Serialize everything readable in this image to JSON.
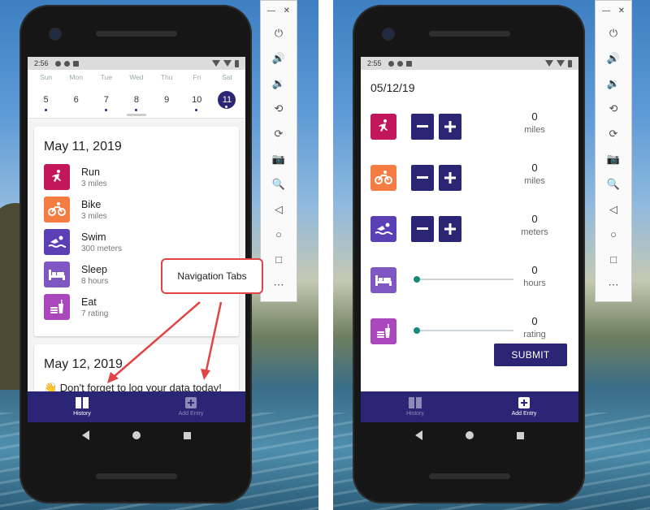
{
  "left": {
    "status": {
      "time": "2:56"
    },
    "week": {
      "days": [
        {
          "name": "Sun",
          "num": "5",
          "dot": true,
          "selected": false
        },
        {
          "name": "Mon",
          "num": "6",
          "dot": false,
          "selected": false
        },
        {
          "name": "Tue",
          "num": "7",
          "dot": true,
          "selected": false
        },
        {
          "name": "Wed",
          "num": "8",
          "dot": true,
          "selected": false
        },
        {
          "name": "Thu",
          "num": "9",
          "dot": false,
          "selected": false
        },
        {
          "name": "Fri",
          "num": "10",
          "dot": true,
          "selected": false
        },
        {
          "name": "Sat",
          "num": "11",
          "dot": true,
          "selected": true
        }
      ]
    },
    "card1": {
      "date": "May 11, 2019",
      "activities": [
        {
          "name": "Run",
          "detail": "3 miles",
          "icon": "run-icon",
          "color": "#c2185b"
        },
        {
          "name": "Bike",
          "detail": "3 miles",
          "icon": "bike-icon",
          "color": "#f57c42"
        },
        {
          "name": "Swim",
          "detail": "300 meters",
          "icon": "swim-icon",
          "color": "#5a3fb5"
        },
        {
          "name": "Sleep",
          "detail": "8 hours",
          "icon": "bed-icon",
          "color": "#7e57c2"
        },
        {
          "name": "Eat",
          "detail": "7 rating",
          "icon": "food-icon",
          "color": "#ab47bc"
        }
      ]
    },
    "card2": {
      "date": "May 12, 2019",
      "reminder": "👋 Don't forget to log your data today!"
    },
    "callout": "Navigation Tabs",
    "nav": {
      "history": "History",
      "add_entry": "Add Entry"
    }
  },
  "right": {
    "status": {
      "time": "2:55"
    },
    "date": "05/12/19",
    "entries": [
      {
        "icon": "run-icon",
        "color": "#c2185b",
        "value": "0",
        "unit": "miles",
        "control": "stepper"
      },
      {
        "icon": "bike-icon",
        "color": "#f57c42",
        "value": "0",
        "unit": "miles",
        "control": "stepper"
      },
      {
        "icon": "swim-icon",
        "color": "#5a3fb5",
        "value": "0",
        "unit": "meters",
        "control": "stepper"
      },
      {
        "icon": "bed-icon",
        "color": "#7e57c2",
        "value": "0",
        "unit": "hours",
        "control": "slider"
      },
      {
        "icon": "food-icon",
        "color": "#ab47bc",
        "value": "0",
        "unit": "rating",
        "control": "slider"
      }
    ],
    "submit": "SUBMIT",
    "nav": {
      "history": "History",
      "add_entry": "Add Entry"
    }
  },
  "colors": {
    "primary": "#2b2575",
    "callout_border": "#e04444",
    "slider_knob": "#138a7a"
  }
}
